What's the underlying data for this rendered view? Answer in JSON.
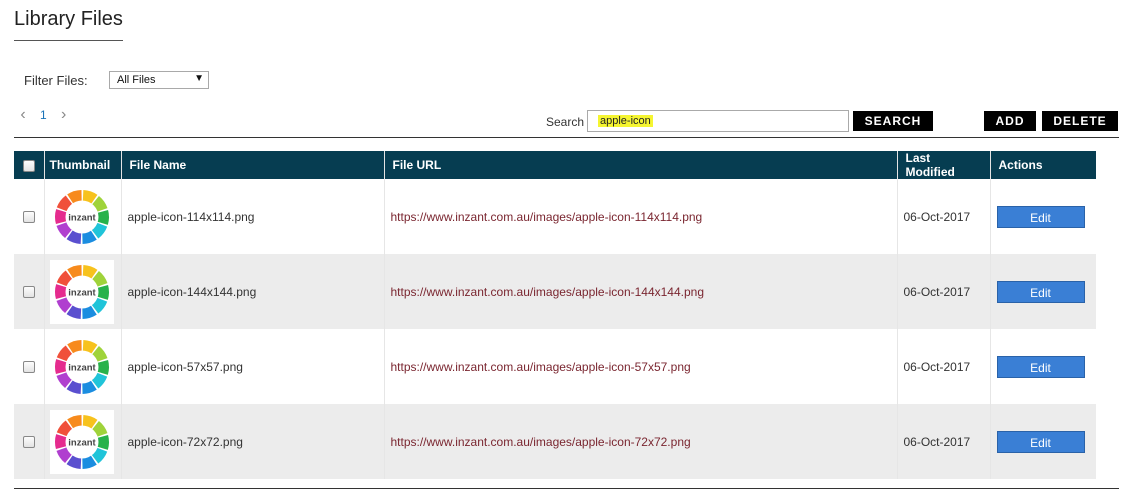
{
  "page": {
    "title": "Library Files"
  },
  "filter": {
    "label": "Filter Files:",
    "selected": "All Files",
    "caret": "▼"
  },
  "pager": {
    "prev": "‹",
    "current": "1",
    "next": "›"
  },
  "search": {
    "label": "Search",
    "value": "apple-icon",
    "button": "SEARCH"
  },
  "actions": {
    "add": "ADD",
    "delete": "DELETE"
  },
  "table": {
    "headers": {
      "thumbnail": "Thumbnail",
      "file_name": "File Name",
      "file_url": "File URL",
      "last_modified": "Last Modified",
      "actions": "Actions"
    },
    "rows": [
      {
        "file_name": "apple-icon-114x114.png",
        "file_url": "https://www.inzant.com.au/images/apple-icon-114x114.png",
        "last_modified": "06-Oct-2017",
        "edit": "Edit",
        "logo_text": "inzant"
      },
      {
        "file_name": "apple-icon-144x144.png",
        "file_url": "https://www.inzant.com.au/images/apple-icon-144x144.png",
        "last_modified": "06-Oct-2017",
        "edit": "Edit",
        "logo_text": "inzant"
      },
      {
        "file_name": "apple-icon-57x57.png",
        "file_url": "https://www.inzant.com.au/images/apple-icon-57x57.png",
        "last_modified": "06-Oct-2017",
        "edit": "Edit",
        "logo_text": "inzant"
      },
      {
        "file_name": "apple-icon-72x72.png",
        "file_url": "https://www.inzant.com.au/images/apple-icon-72x72.png",
        "last_modified": "06-Oct-2017",
        "edit": "Edit",
        "logo_text": "inzant"
      }
    ]
  },
  "colors": {
    "header_bg": "#063d51",
    "edit_button": "#3a7fd5",
    "search_highlight": "#f5f531",
    "url_text": "#7a2630"
  },
  "icons": {
    "prev": "chevron-left-icon",
    "next": "chevron-right-icon",
    "dropdown": "caret-down-icon",
    "thumbnail": "inzant-logo-icon"
  }
}
